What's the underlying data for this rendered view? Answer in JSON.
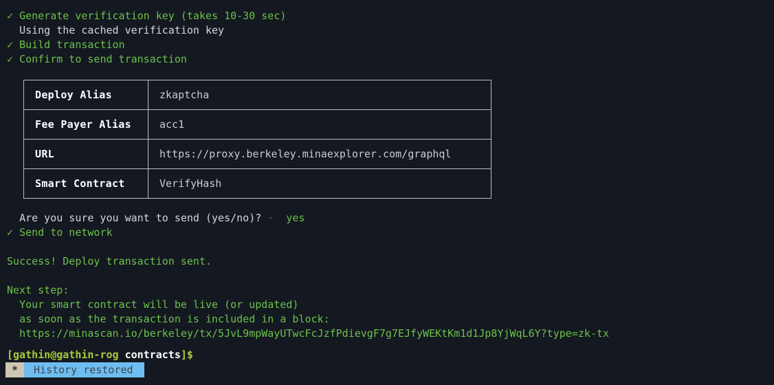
{
  "terminal": {
    "background_color": "#141821",
    "foreground_color": "#d8dee9",
    "accent_green": "#6cc24a",
    "accent_yellow": "#b5cc3a",
    "status_highlight": "#6fbdf0",
    "status_mark_bg": "#cfc6b4"
  },
  "output": {
    "check_glyph": "✓",
    "lines": [
      {
        "id": "generate_key",
        "text": "Generate verification key (takes 10-30 sec)"
      },
      {
        "id": "cached_key",
        "text": "Using the cached verification key"
      },
      {
        "id": "build_tx",
        "text": "Build transaction"
      },
      {
        "id": "confirm_tx",
        "text": "Confirm to send transaction"
      }
    ]
  },
  "table": {
    "rows": [
      {
        "label": "Deploy Alias",
        "value": "zkaptcha"
      },
      {
        "label": "Fee Payer Alias",
        "value": "acc1"
      },
      {
        "label": "URL",
        "value": "https://proxy.berkeley.minaexplorer.com/graphql"
      },
      {
        "label": "Smart Contract",
        "value": "VerifyHash"
      }
    ]
  },
  "confirm": {
    "question": "Are you sure you want to send (yes/no)?",
    "separator": "·",
    "answer": "yes"
  },
  "send": {
    "label": "Send to network"
  },
  "success": {
    "message": "Success! Deploy transaction sent."
  },
  "next_step": {
    "heading": "Next step:",
    "line1": "Your smart contract will be live (or updated)",
    "line2": "as soon as the transaction is included in a block:",
    "url": "https://minascan.io/berkeley/tx/5JvL9mpWayUTwcFcJzfPdievgF7g7EJfyWEKtKm1d1Jp8YjWqL6Y?type=zk-tx"
  },
  "prompt": {
    "open_bracket": "[",
    "user_host": "gathin@gathin-rog",
    "space": " ",
    "directory": "contracts",
    "close_bracket": "]",
    "symbol": "$"
  },
  "statusbar": {
    "mark": "*",
    "message": "History restored"
  }
}
